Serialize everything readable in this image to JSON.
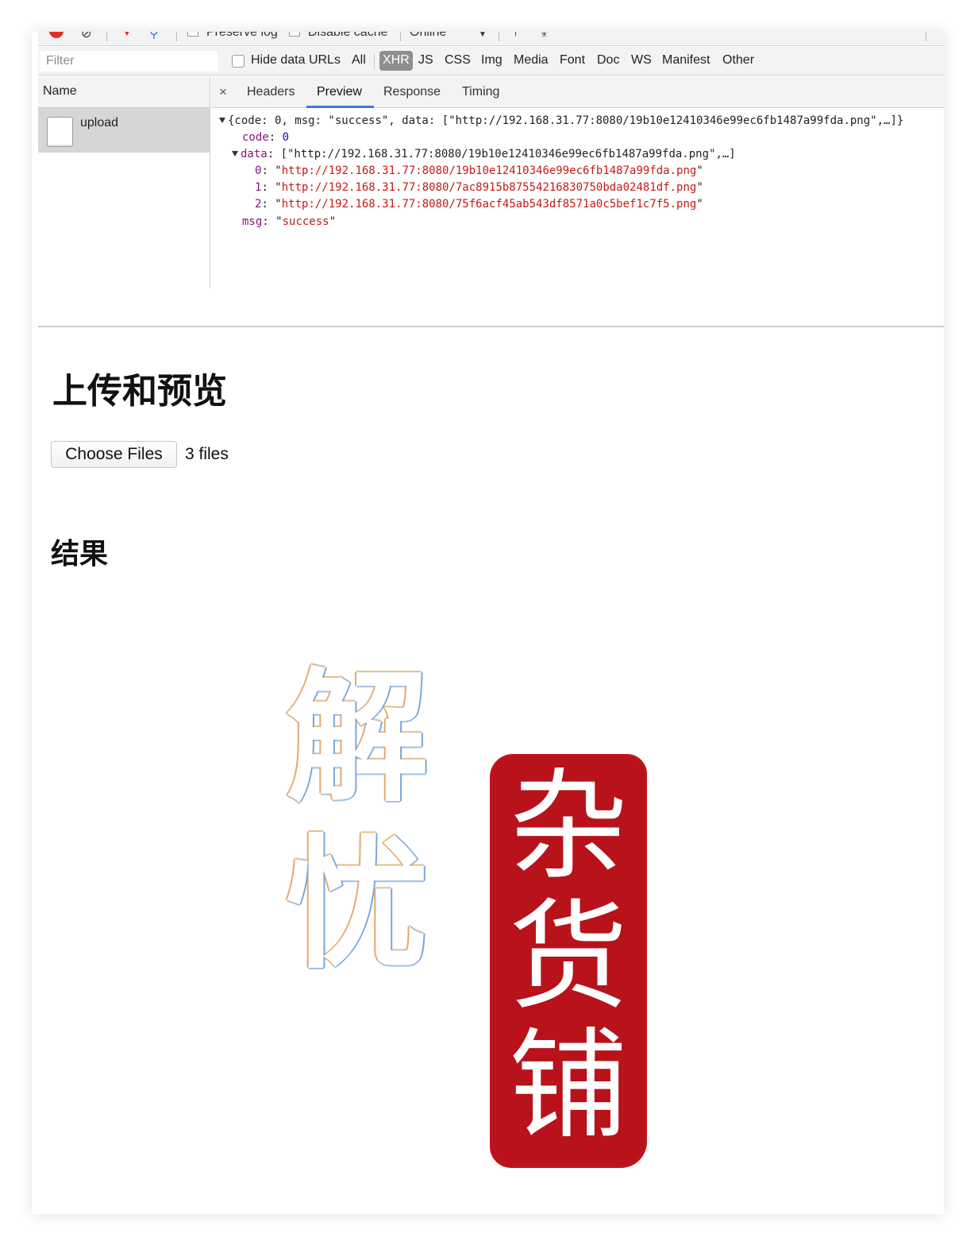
{
  "devtools": {
    "toolbar": {
      "preserve_log": "Preserve log",
      "disable_cache": "Disable cache",
      "throttle": "Online"
    },
    "filter": {
      "placeholder": "Filter",
      "hide_data_urls": "Hide data URLs",
      "types": [
        "All",
        "XHR",
        "JS",
        "CSS",
        "Img",
        "Media",
        "Font",
        "Doc",
        "WS",
        "Manifest",
        "Other"
      ],
      "active_type": "XHR"
    },
    "requests": {
      "header": "Name",
      "items": [
        {
          "name": "upload"
        }
      ]
    },
    "tabs": {
      "close": "×",
      "items": [
        "Headers",
        "Preview",
        "Response",
        "Timing"
      ],
      "active": "Preview"
    },
    "preview": {
      "summary": "{code: 0, msg: \"success\", data: [\"http://192.168.31.77:8080/19b10e12410346e99ec6fb1487a99fda.png\",…]}",
      "code_key": "code",
      "code_value": "0",
      "data_key": "data",
      "data_summary": "[\"http://192.168.31.77:8080/19b10e12410346e99ec6fb1487a99fda.png\",…]",
      "data_items": [
        "http://192.168.31.77:8080/19b10e12410346e99ec6fb1487a99fda.png",
        "http://192.168.31.77:8080/7ac8915b87554216830750bda02481df.png",
        "http://192.168.31.77:8080/75f6acf45ab543df8571a0c5bef1c7f5.png"
      ],
      "msg_key": "msg",
      "msg_value": "success"
    }
  },
  "page": {
    "title": "上传和预览",
    "choose_button": "Choose Files",
    "files_count": "3 files",
    "result_title": "结果",
    "images": [
      {
        "text_1": "解",
        "text_2": "忧",
        "style": "outlined"
      },
      {
        "text_1": "杂",
        "text_2": "货",
        "text_3": "铺",
        "style": "red-seal",
        "color": "#b8121b"
      }
    ]
  }
}
